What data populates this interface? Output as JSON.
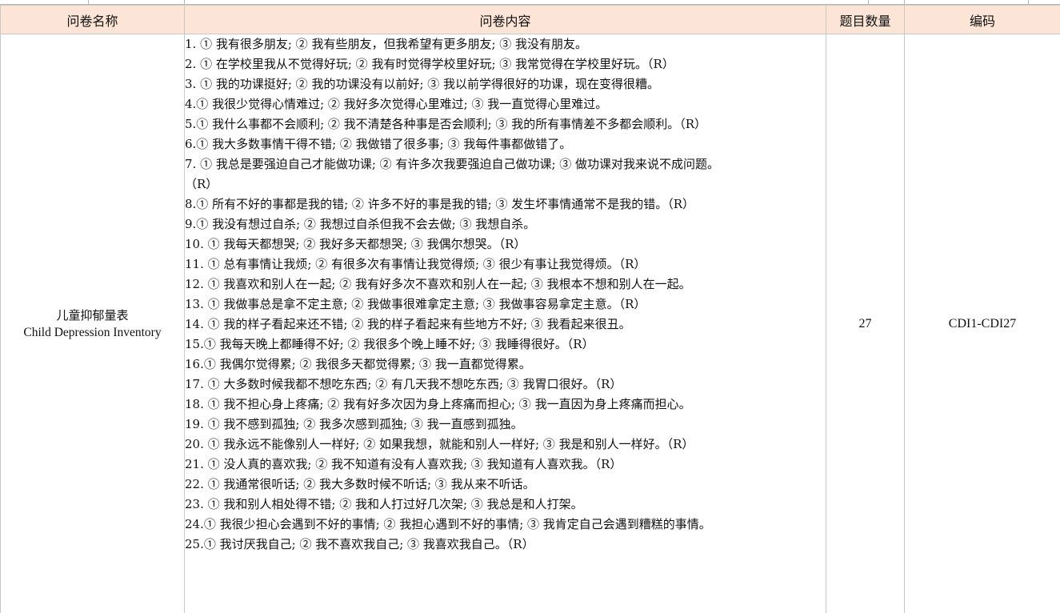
{
  "header": {
    "col_name": "问卷名称",
    "col_content": "问卷内容",
    "col_count": "题目数量",
    "col_code": "编码"
  },
  "row": {
    "name_cn": "儿童抑郁量表",
    "name_en": "Child Depression Inventory",
    "count": "27",
    "code": "CDI1-CDI27",
    "items": [
      "1. ① 我有很多朋友; ② 我有些朋友，但我希望有更多朋友; ③ 我没有朋友。",
      "2. ① 在学校里我从不觉得好玩; ② 我有时觉得学校里好玩; ③ 我常觉得在学校里好玩。（R）",
      "3. ① 我的功课挺好; ② 我的功课没有以前好; ③ 我以前学得很好的功课，现在变得很糟。",
      "4.① 我很少觉得心情难过; ② 我好多次觉得心里难过; ③ 我一直觉得心里难过。",
      "5.① 我什么事都不会顺利; ② 我不清楚各种事是否会顺利; ③ 我的所有事情差不多都会顺利。（R）",
      "6.① 我大多数事情干得不错; ② 我做错了很多事; ③ 我每件事都做错了。",
      "7. ① 我总是要强迫自己才能做功课; ② 有许多次我要强迫自己做功课; ③ 做功课对我来说不成问题。",
      "（R）",
      "8.① 所有不好的事都是我的错; ② 许多不好的事是我的错; ③ 发生坏事情通常不是我的错。（R）",
      "9.① 我没有想过自杀; ② 我想过自杀但我不会去做; ③ 我想自杀。",
      "10. ① 我每天都想哭; ② 我好多天都想哭; ③ 我偶尔想哭。（R）",
      "11. ① 总有事情让我烦; ② 有很多次有事情让我觉得烦; ③ 很少有事让我觉得烦。（R）",
      "12. ① 我喜欢和别人在一起; ② 我有好多次不喜欢和别人在一起; ③ 我根本不想和别人在一起。",
      "13. ① 我做事总是拿不定主意; ② 我做事很难拿定主意; ③ 我做事容易拿定主意。（R）",
      "14. ① 我的样子看起来还不错; ② 我的样子看起来有些地方不好; ③ 我看起来很丑。",
      "15.① 我每天晚上都睡得不好; ② 我很多个晚上睡不好; ③ 我睡得很好。（R）",
      "16.① 我偶尔觉得累; ② 我很多天都觉得累; ③ 我一直都觉得累。",
      "17. ① 大多数时候我都不想吃东西; ② 有几天我不想吃东西; ③ 我胃口很好。（R）",
      "18. ① 我不担心身上疼痛; ② 我有好多次因为身上疼痛而担心; ③ 我一直因为身上疼痛而担心。",
      "19. ① 我不感到孤独; ② 我多次感到孤独; ③ 我一直感到孤独。",
      "20. ① 我永远不能像别人一样好; ② 如果我想，就能和别人一样好; ③ 我是和别人一样好。（R）",
      "21. ① 没人真的喜欢我; ② 我不知道有没有人喜欢我; ③ 我知道有人喜欢我。（R）",
      "22. ① 我通常很听话; ② 我大多数时候不听话; ③ 我从来不听话。",
      "23. ① 我和别人相处得不错; ② 我和人打过好几次架; ③ 我总是和人打架。",
      "24.① 我很少担心会遇到不好的事情; ② 我担心遇到不好的事情; ③ 我肯定自己会遇到糟糕的事情。",
      "25.① 我讨厌我自己; ② 我不喜欢我自己; ③ 我喜欢我自己。（R）"
    ]
  },
  "colors": {
    "header_bg": "#fce4d6",
    "grid_line": "#c8c8c8"
  }
}
